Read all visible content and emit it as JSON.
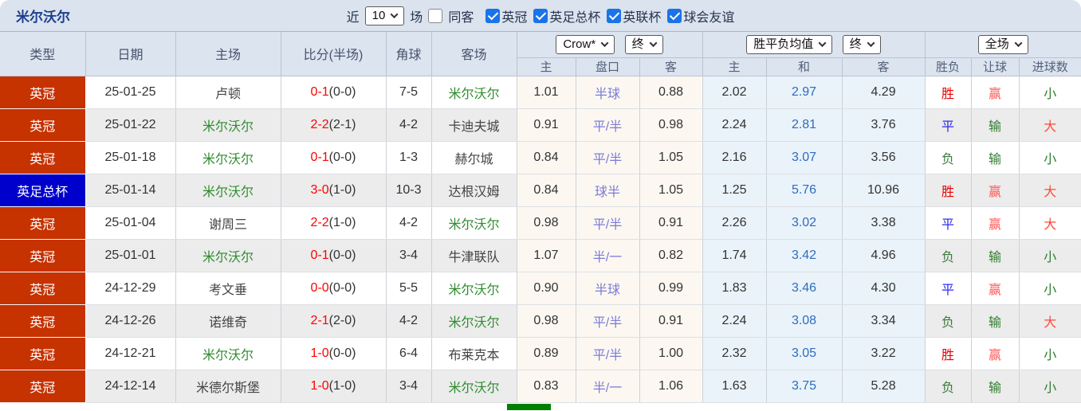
{
  "topbar": {
    "title": "米尔沃尔",
    "near_label": "近",
    "match_count": "10",
    "games_label": "场",
    "same_away_label": "同客",
    "same_away_checked": false,
    "filters": [
      {
        "label": "英冠",
        "checked": true
      },
      {
        "label": "英足总杯",
        "checked": true
      },
      {
        "label": "英联杯",
        "checked": true
      },
      {
        "label": "球会友谊",
        "checked": true
      }
    ]
  },
  "table": {
    "header_cols": [
      "类型",
      "日期",
      "主场",
      "比分(半场)",
      "角球",
      "客场"
    ],
    "selects": {
      "odds_source": "Crow*",
      "odds_source_state": "终",
      "avg_label": "胜平负均值",
      "avg_state": "终",
      "scope": "全场"
    },
    "sub_headers": [
      "主",
      "盘口",
      "客",
      "主",
      "和",
      "客",
      "胜负",
      "让球",
      "进球数"
    ],
    "rows": [
      {
        "league": "英冠",
        "league_color": "red",
        "date": "25-01-25",
        "home": "卢顿",
        "home_self": false,
        "score": "0-1",
        "half": "(0-0)",
        "corner": "7-5",
        "away": "米尔沃尔",
        "away_self": true,
        "ah_home": "1.01",
        "ah_line": "半球",
        "ah_away": "0.88",
        "eu_home": "2.02",
        "eu_draw": "2.97",
        "eu_away": "4.29",
        "res_outcome": "胜",
        "res_handicap": "赢",
        "res_goals": "小"
      },
      {
        "league": "英冠",
        "league_color": "red",
        "date": "25-01-22",
        "home": "米尔沃尔",
        "home_self": true,
        "score": "2-2",
        "half": "(2-1)",
        "corner": "4-2",
        "away": "卡迪夫城",
        "away_self": false,
        "ah_home": "0.91",
        "ah_line": "平/半",
        "ah_away": "0.98",
        "eu_home": "2.24",
        "eu_draw": "2.81",
        "eu_away": "3.76",
        "res_outcome": "平",
        "res_handicap": "输",
        "res_goals": "大"
      },
      {
        "league": "英冠",
        "league_color": "red",
        "date": "25-01-18",
        "home": "米尔沃尔",
        "home_self": true,
        "score": "0-1",
        "half": "(0-0)",
        "corner": "1-3",
        "away": "赫尔城",
        "away_self": false,
        "ah_home": "0.84",
        "ah_line": "平/半",
        "ah_away": "1.05",
        "eu_home": "2.16",
        "eu_draw": "3.07",
        "eu_away": "3.56",
        "res_outcome": "负",
        "res_handicap": "输",
        "res_goals": "小"
      },
      {
        "league": "英足总杯",
        "league_color": "blue",
        "date": "25-01-14",
        "home": "米尔沃尔",
        "home_self": true,
        "score": "3-0",
        "half": "(1-0)",
        "corner": "10-3",
        "away": "达根汉姆",
        "away_self": false,
        "ah_home": "0.84",
        "ah_line": "球半",
        "ah_away": "1.05",
        "eu_home": "1.25",
        "eu_draw": "5.76",
        "eu_away": "10.96",
        "res_outcome": "胜",
        "res_handicap": "赢",
        "res_goals": "大"
      },
      {
        "league": "英冠",
        "league_color": "red",
        "date": "25-01-04",
        "home": "谢周三",
        "home_self": false,
        "score": "2-2",
        "half": "(1-0)",
        "corner": "4-2",
        "away": "米尔沃尔",
        "away_self": true,
        "ah_home": "0.98",
        "ah_line": "平/半",
        "ah_away": "0.91",
        "eu_home": "2.26",
        "eu_draw": "3.02",
        "eu_away": "3.38",
        "res_outcome": "平",
        "res_handicap": "赢",
        "res_goals": "大"
      },
      {
        "league": "英冠",
        "league_color": "red",
        "date": "25-01-01",
        "home": "米尔沃尔",
        "home_self": true,
        "score": "0-1",
        "half": "(0-0)",
        "corner": "3-4",
        "away": "牛津联队",
        "away_self": false,
        "ah_home": "1.07",
        "ah_line": "半/一",
        "ah_away": "0.82",
        "eu_home": "1.74",
        "eu_draw": "3.42",
        "eu_away": "4.96",
        "res_outcome": "负",
        "res_handicap": "输",
        "res_goals": "小"
      },
      {
        "league": "英冠",
        "league_color": "red",
        "date": "24-12-29",
        "home": "考文垂",
        "home_self": false,
        "score": "0-0",
        "half": "(0-0)",
        "corner": "5-5",
        "away": "米尔沃尔",
        "away_self": true,
        "ah_home": "0.90",
        "ah_line": "半球",
        "ah_away": "0.99",
        "eu_home": "1.83",
        "eu_draw": "3.46",
        "eu_away": "4.30",
        "res_outcome": "平",
        "res_handicap": "赢",
        "res_goals": "小"
      },
      {
        "league": "英冠",
        "league_color": "red",
        "date": "24-12-26",
        "home": "诺维奇",
        "home_self": false,
        "score": "2-1",
        "half": "(2-0)",
        "corner": "4-2",
        "away": "米尔沃尔",
        "away_self": true,
        "ah_home": "0.98",
        "ah_line": "平/半",
        "ah_away": "0.91",
        "eu_home": "2.24",
        "eu_draw": "3.08",
        "eu_away": "3.34",
        "res_outcome": "负",
        "res_handicap": "输",
        "res_goals": "大"
      },
      {
        "league": "英冠",
        "league_color": "red",
        "date": "24-12-21",
        "home": "米尔沃尔",
        "home_self": true,
        "score": "1-0",
        "half": "(0-0)",
        "corner": "6-4",
        "away": "布莱克本",
        "away_self": false,
        "ah_home": "0.89",
        "ah_line": "平/半",
        "ah_away": "1.00",
        "eu_home": "2.32",
        "eu_draw": "3.05",
        "eu_away": "3.22",
        "res_outcome": "胜",
        "res_handicap": "赢",
        "res_goals": "小"
      },
      {
        "league": "英冠",
        "league_color": "red",
        "date": "24-12-14",
        "home": "米德尔斯堡",
        "home_self": false,
        "score": "1-0",
        "half": "(1-0)",
        "corner": "3-4",
        "away": "米尔沃尔",
        "away_self": true,
        "ah_home": "0.83",
        "ah_line": "半/一",
        "ah_away": "1.06",
        "eu_home": "1.63",
        "eu_draw": "3.75",
        "eu_away": "5.28",
        "res_outcome": "负",
        "res_handicap": "输",
        "res_goals": "小"
      }
    ]
  },
  "colors": {
    "league": {
      "red": "#c63200",
      "blue": "#0000cc"
    },
    "self_team": "#2e8b2e",
    "other_team": "#444444",
    "score": "#ff0000",
    "half_score": "#333333",
    "handicap_line_text": "#7b7bd8",
    "draw_odds_text": "#2f6bbf",
    "results": {
      "胜": "#e60000",
      "平": "#2b2bef",
      "负": "#3d7a3d",
      "赢": "#fc5b5b",
      "输": "#2e7d2e",
      "大": "#fd4a38",
      "小": "#2e7d2e"
    }
  }
}
